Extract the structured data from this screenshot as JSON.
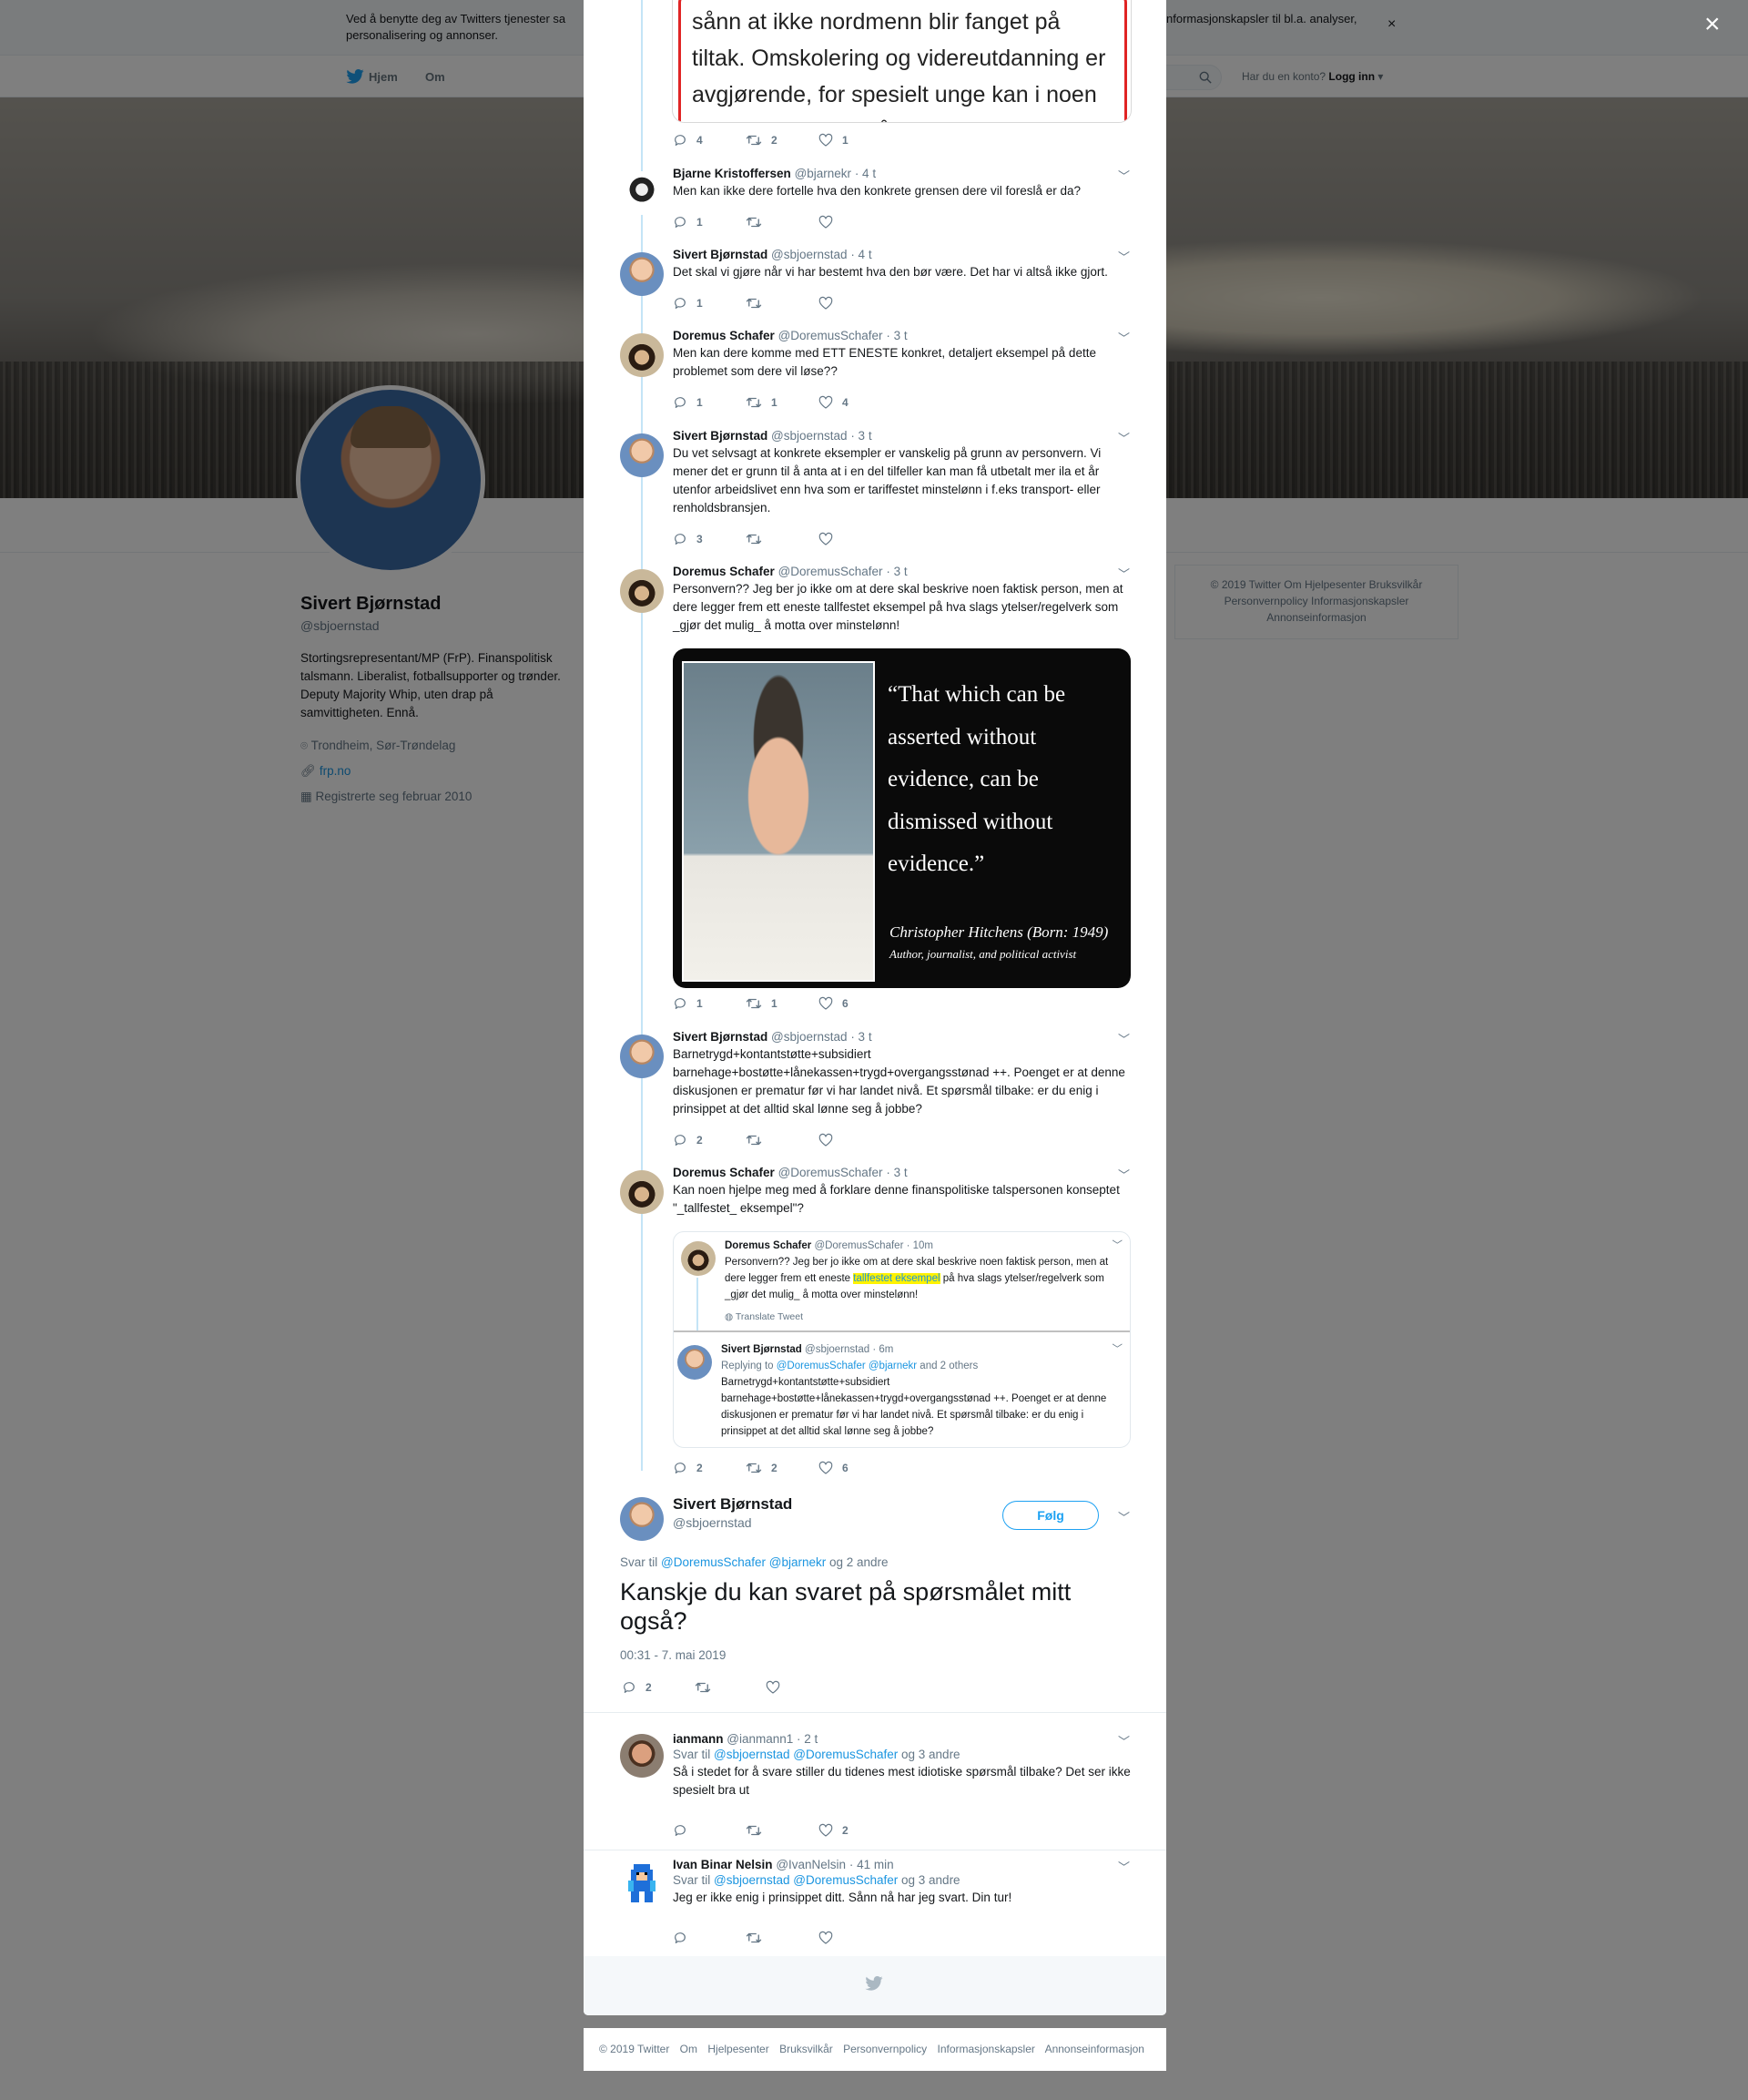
{
  "cookie": {
    "text_left": "Ved å benytte deg av Twitters tjenester sa",
    "text_left_2": "personalisering og annonser.",
    "text_right": "nformasjonskapsler til bl.a. analyser,",
    "close": "×"
  },
  "topnav": {
    "home": "Hjem",
    "about": "Om",
    "account_q": "Har du en konto?",
    "login": "Logg inn"
  },
  "profile": {
    "name": "Sivert Bjørnstad",
    "handle": "@sbjoernstad",
    "bio": "Stortingsrepresentant/MP (FrP). Finanspolitisk talsmann. Liberalist, fotballsupporter og trønder. Deputy Majority Whip, uten drap på samvittigheten. Ennå.",
    "location": "Trondheim, Sør-Trøndelag",
    "website": "frp.no",
    "joined": "Registrerte seg februar 2010"
  },
  "right_footer": {
    "line1": "© 2019 Twitter   Om   Hjelpesenter   Bruksvilkår",
    "line2": "Personvernpolicy   Informasjonskapsler",
    "line3": "Annonseinformasjon"
  },
  "modal_close": "×",
  "cut_tweet": {
    "image_text": "sånn at ikke nordmenn blir fanget på tiltak. Omskolering og videreutdanning er avgjørende, for spesielt unge kan i noen tilfeller tjene mer på tiltaksordninger enn ved å",
    "replies": "4",
    "retweets": "2",
    "likes": "1"
  },
  "thread": [
    {
      "name": "Bjarne Kristoffersen",
      "handle": "@bjarnekr",
      "time": "· 4 t",
      "text": "Men kan ikke dere fortelle hva den konkrete grensen dere vil foreslå er da?",
      "replies": "1",
      "retweets": "",
      "likes": ""
    },
    {
      "name": "Sivert Bjørnstad",
      "handle": "@sbjoernstad",
      "time": "· 4 t",
      "text": "Det skal vi gjøre når vi har bestemt hva den bør være. Det har vi altså ikke gjort.",
      "replies": "1",
      "retweets": "",
      "likes": ""
    },
    {
      "name": "Doremus Schafer",
      "handle": "@DoremusSchafer",
      "time": "· 3 t",
      "text": "Men kan dere komme med ETT ENESTE konkret, detaljert eksempel på dette problemet som dere vil løse??",
      "replies": "1",
      "retweets": "1",
      "likes": "4"
    },
    {
      "name": "Sivert Bjørnstad",
      "handle": "@sbjoernstad",
      "time": "· 3 t",
      "text": "Du vet selvsagt at konkrete eksempler er vanskelig på grunn av personvern. Vi mener det er grunn til å anta at i en del tilfeller kan man få utbetalt mer ila et år utenfor arbeidslivet enn hva som er tariffestet minstelønn i f.eks transport- eller renholdsbransjen.",
      "replies": "3",
      "retweets": "",
      "likes": ""
    },
    {
      "name": "Doremus Schafer",
      "handle": "@DoremusSchafer",
      "time": "· 3 t",
      "text": "Personvern?? Jeg ber jo ikke om at dere skal beskrive noen faktisk person, men at dere legger frem ett eneste tallfestet eksempel på hva slags ytelser/regelverk som _gjør det mulig_ å motta over minstelønn!",
      "replies": "1",
      "retweets": "1",
      "likes": "6"
    },
    {
      "name": "Sivert Bjørnstad",
      "handle": "@sbjoernstad",
      "time": "· 3 t",
      "text": "Barnetrygd+kontantstøtte+subsidiert barnehage+bostøtte+lånekassen+trygd+overgangsstønad ++. Poenget er at denne diskusjonen er prematur før vi har landet nivå. Et spørsmål tilbake: er du enig i prinsippet at det alltid skal lønne seg å jobbe?",
      "replies": "2",
      "retweets": "",
      "likes": ""
    },
    {
      "name": "Doremus Schafer",
      "handle": "@DoremusSchafer",
      "time": "· 3 t",
      "text": "Kan noen hjelpe meg med å forklare denne finanspolitiske talspersonen konseptet \"_tallfestet_ eksempel\"?",
      "replies": "2",
      "retweets": "2",
      "likes": "6"
    }
  ],
  "hitchens": {
    "quote": "“That which can be asserted without evidence, can be dismissed without evidence.”",
    "author": "Christopher Hitchens (Born: 1949)",
    "subtitle": "Author, journalist, and political activist"
  },
  "screenshot": {
    "top_name": "Doremus Schafer",
    "top_meta": "@DoremusSchafer · 10m",
    "top_text_a": "Personvern?? Jeg ber jo ikke om at dere skal beskrive noen faktisk person, men at dere legger frem ett eneste ",
    "top_highlight": "tallfestet eksempel",
    "top_text_b": " på hva slags ytelser/regelverk som _gjør det mulig_ å motta over minstelønn!",
    "translate": "Translate Tweet",
    "bot_name": "Sivert Bjørnstad",
    "bot_meta": "@sbjoernstad · 6m",
    "bot_reply_prefix": "Replying to ",
    "bot_reply_links": "@DoremusSchafer @bjarnekr",
    "bot_reply_suffix": " and 2 others",
    "bot_text": "Barnetrygd+kontantstøtte+subsidiert barnehage+bostøtte+lånekassen+trygd+overgangsstønad ++. Poenget er at denne diskusjonen er prematur før vi har landet nivå. Et spørsmål tilbake: er du enig i prinsippet at det alltid skal lønne seg å jobbe?"
  },
  "main_tweet": {
    "name": "Sivert Bjørnstad",
    "handle": "@sbjoernstad",
    "follow": "Følg",
    "reply_prefix": "Svar til ",
    "reply_links": "@DoremusSchafer @bjarnekr",
    "reply_suffix": " og 2 andre",
    "text": "Kanskje du kan svaret på spørsmålet mitt også?",
    "timestamp": "00:31 - 7. mai 2019",
    "replies": "2",
    "retweets": "",
    "likes": ""
  },
  "replies": [
    {
      "name": "ianmann",
      "handle": "@ianmann1",
      "time": "· 2 t",
      "reply_prefix": "Svar til ",
      "reply_links": "@sbjoernstad @DoremusSchafer",
      "reply_suffix": " og 3 andre",
      "text": "Så i stedet for å svare stiller du tidenes mest idiotiske spørsmål tilbake? Det ser ikke spesielt bra ut",
      "replies": "",
      "retweets": "",
      "likes": "2"
    },
    {
      "name": "Ivan Binar Nelsin",
      "handle": "@IvanNelsin",
      "time": "· 41 min",
      "reply_prefix": "Svar til ",
      "reply_links": "@sbjoernstad @DoremusSchafer",
      "reply_suffix": " og 3 andre",
      "text": "Jeg er ikke enig i prinsippet ditt. Sånn nå har jeg svart. Din tur!",
      "replies": "",
      "retweets": "",
      "likes": ""
    }
  ],
  "bottom_footer": [
    "© 2019 Twitter",
    "Om",
    "Hjelpesenter",
    "Bruksvilkår",
    "Personvernpolicy",
    "Informasjonskapsler",
    "Annonseinformasjon"
  ],
  "colors": {
    "accent": "#1da1f2",
    "link": "#1b95e0",
    "muted": "#657786",
    "thread_line": "#c4e4f6"
  }
}
